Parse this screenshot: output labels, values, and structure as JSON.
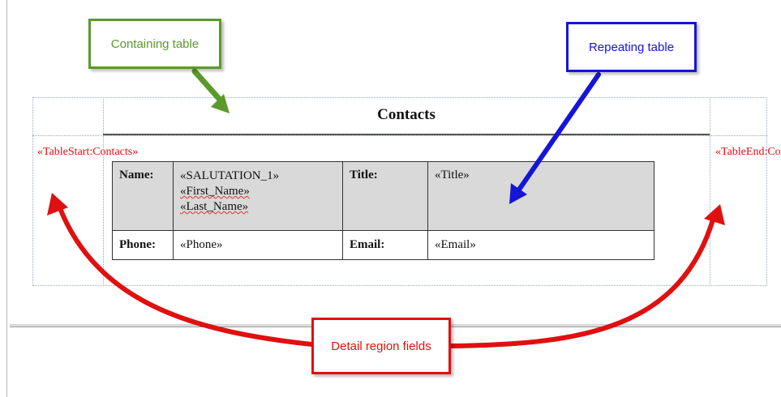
{
  "callouts": {
    "containing_table": "Containing table",
    "repeating_table": "Repeating table",
    "detail_region_fields": "Detail region fields"
  },
  "containing": {
    "title": "Contacts",
    "field_start": "«TableStart:Contacts»",
    "field_end": "«TableEnd:Contacts»"
  },
  "repeating": {
    "row1": {
      "label1": "Name:",
      "value1_lines": [
        "«SALUTATION_1»",
        "«First_Name»",
        "«Last_Name»"
      ],
      "label2": "Title:",
      "value2": "«Title»"
    },
    "row2": {
      "label1": "Phone:",
      "value1": "«Phone»",
      "label2": "Email:",
      "value2": "«Email»"
    }
  },
  "colors": {
    "green": "#5a9a2a",
    "blue": "#1515d8",
    "red": "#e01010",
    "shaded_row": "#d9d9d9"
  }
}
